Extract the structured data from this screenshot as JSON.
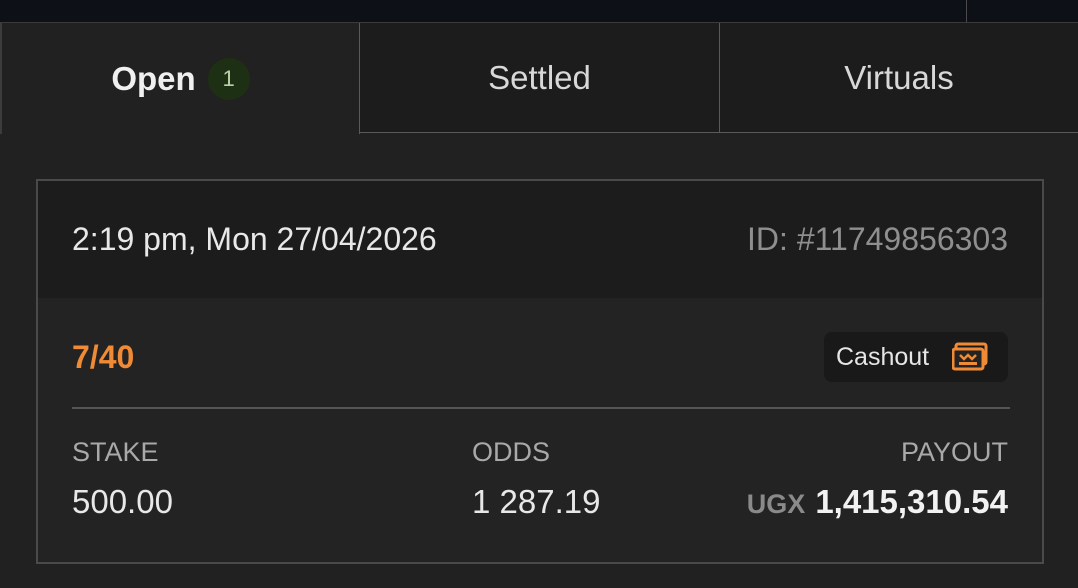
{
  "tabs": [
    {
      "label": "Open",
      "badge": "1"
    },
    {
      "label": "Settled"
    },
    {
      "label": "Virtuals"
    }
  ],
  "bet": {
    "datetime": "2:19 pm, Mon 27/04/2026",
    "id": "ID: #11749856303",
    "legs": "7/40",
    "cashout_label": "Cashout",
    "stake_label": "STAKE",
    "stake_value": "500.00",
    "odds_label": "ODDS",
    "odds_value": "1 287.19",
    "payout_label": "PAYOUT",
    "payout_currency": "UGX",
    "payout_value": "1,415,310.54"
  },
  "colors": {
    "accent": "#ef8a36",
    "badge_bg": "#1e3014",
    "background": "#212121"
  },
  "icons": {
    "cashout": "cashout-money-icon"
  }
}
